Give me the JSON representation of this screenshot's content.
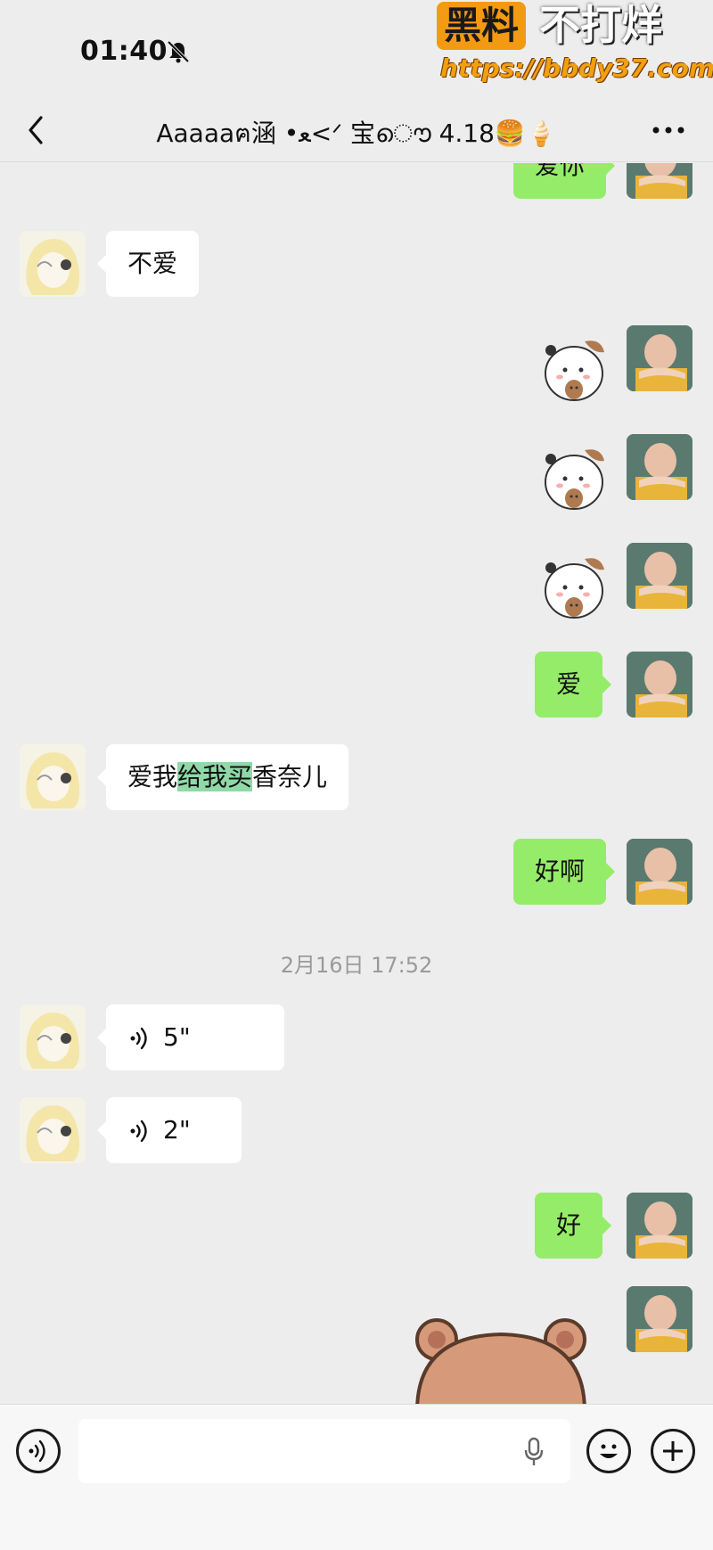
{
  "status": {
    "time": "01:40"
  },
  "watermark": {
    "badge": "黑料",
    "text": "不打烊",
    "url": "https://bbdy37.com"
  },
  "nav": {
    "title": "Aaaaaฅ涵 •ﻌ<ᐟ 宝ൌ 4.18🍔🍦"
  },
  "messages": {
    "m0": "爱你",
    "m1": "不爱",
    "m2": "爱",
    "m3_pre": "爱我",
    "m3_hl": "给我买",
    "m3_post": "香奈儿",
    "m4": "好啊",
    "time1": "2月16日 17:52",
    "v1": "5\"",
    "v2": "2\"",
    "m5": "好"
  },
  "input": {
    "placeholder": ""
  },
  "colors": {
    "background": "#ededed",
    "outgoing_bubble": "#95ec69",
    "incoming_bubble": "#ffffff",
    "watermark_orange": "#f39a12"
  },
  "icons": [
    "mute-bell-icon",
    "back-chevron-icon",
    "more-dots-icon",
    "voice-wave-icon",
    "mic-icon",
    "emoji-icon",
    "plus-icon"
  ]
}
